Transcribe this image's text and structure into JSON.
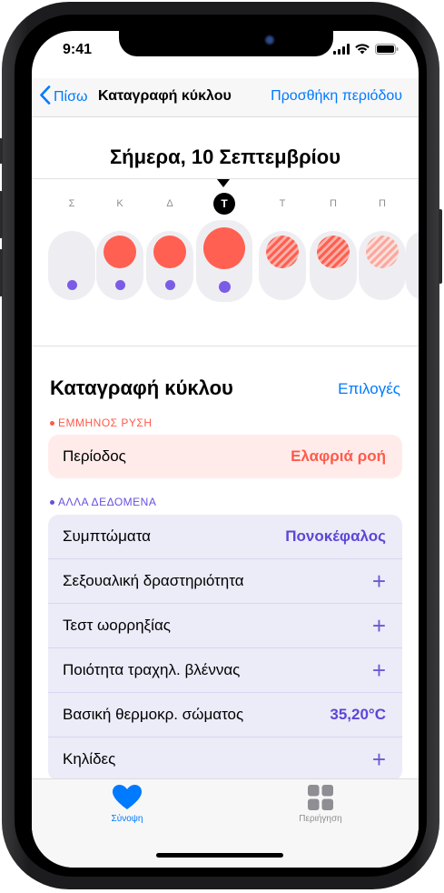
{
  "status_bar": {
    "time": "9:41"
  },
  "nav": {
    "back_label": "Πίσω",
    "title": "Καταγραφή κύκλου",
    "add_label": "Προσθήκη περιόδου"
  },
  "calendar": {
    "date_title": "Σήμερα, 10 Σεπτεμβρίου",
    "days": [
      {
        "letter": "Σ",
        "today": false,
        "flow": "none",
        "symptom": true
      },
      {
        "letter": "Κ",
        "today": false,
        "flow": "logged",
        "symptom": true
      },
      {
        "letter": "Δ",
        "today": false,
        "flow": "logged",
        "symptom": true
      },
      {
        "letter": "Τ",
        "today": true,
        "flow": "logged",
        "symptom": true
      },
      {
        "letter": "Τ",
        "today": false,
        "flow": "predicted",
        "symptom": false
      },
      {
        "letter": "Π",
        "today": false,
        "flow": "predicted",
        "symptom": false
      },
      {
        "letter": "Π",
        "today": false,
        "flow": "predicted-light",
        "symptom": false
      }
    ]
  },
  "cycle_log": {
    "title": "Καταγραφή κύκλου",
    "options_label": "Επιλογές",
    "menstruation": {
      "category": "ΕΜΜΗΝΟΣ ΡΥΣΗ",
      "rows": [
        {
          "label": "Περίοδος",
          "value": "Ελαφριά ροή"
        }
      ]
    },
    "other": {
      "category": "ΑΛΛΑ ΔΕΔΟΜΕΝΑ",
      "rows": [
        {
          "label": "Συμπτώματα",
          "value": "Πονοκέφαλος"
        },
        {
          "label": "Σεξουαλική δραστηριότητα",
          "value": "+"
        },
        {
          "label": "Τεστ ωορρηξίας",
          "value": "+"
        },
        {
          "label": "Ποιότητα τραχηλ. βλέννας",
          "value": "+"
        },
        {
          "label": "Βασική θερμοκρ. σώματος",
          "value": "35,20°C"
        },
        {
          "label": "Κηλίδες",
          "value": "+"
        }
      ]
    }
  },
  "tab_bar": {
    "summary_label": "Σύνοψη",
    "browse_label": "Περιήγηση"
  },
  "colors": {
    "accent": "#007aff",
    "period": "#ff6051",
    "other_data": "#7b5ce6",
    "period_bg": "#ffecea",
    "other_bg": "#ecebf8"
  },
  "icons": [
    "chevron-left-icon",
    "heart-icon",
    "grid-icon",
    "signal-icon",
    "wifi-icon",
    "battery-icon"
  ]
}
